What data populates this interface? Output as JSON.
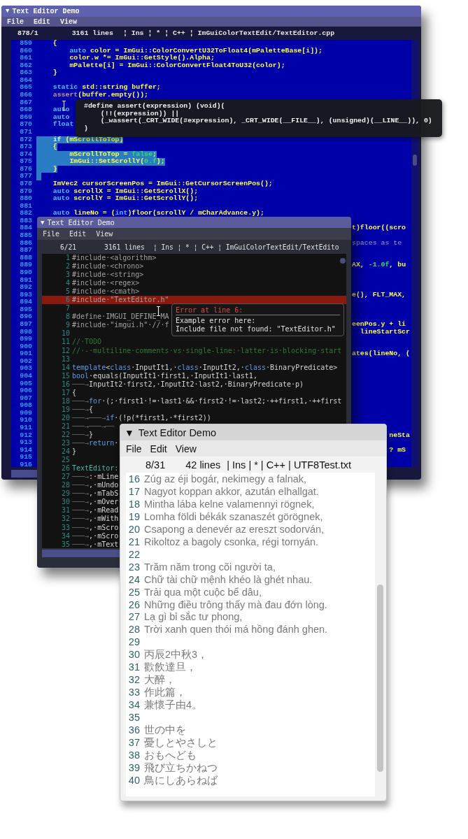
{
  "windows": [
    {
      "kind": "retro-blue",
      "collapse_glyph": "▼",
      "title": "Text Editor Demo",
      "menu": [
        "File",
        "Edit",
        "View"
      ],
      "status": {
        "position": "878/1",
        "lines": "3161 lines",
        "info": "¦ Ins ¦ * ¦ C++ ¦ ImGuiColorTextEdit/TextEditor.cpp"
      },
      "lines": [
        {
          "n": "859",
          "s": [
            {
              "kind": "plain",
              "text": "    {"
            }
          ],
          "selected": false
        },
        {
          "n": "860",
          "s": [
            {
              "kind": "keyword",
              "text": "        auto"
            },
            {
              "kind": "plain",
              "text": " color = ImGui::ColorConvertU32ToFloat4(mPaletteBase[i]);"
            }
          ],
          "selected": false
        },
        {
          "n": "861",
          "s": [
            {
              "kind": "plain",
              "text": "        color.w *= ImGui::GetStyle().Alpha;"
            }
          ],
          "selected": false
        },
        {
          "n": "862",
          "s": [
            {
              "kind": "plain",
              "text": "        mPalette[i] = ImGui::ColorConvertFloat4ToU32(color);"
            }
          ],
          "selected": false
        },
        {
          "n": "863",
          "s": [
            {
              "kind": "plain",
              "text": "    }"
            }
          ],
          "selected": false
        },
        {
          "n": "864",
          "selected": false
        },
        {
          "n": "865",
          "s": [
            {
              "kind": "keyword",
              "text": "    static"
            },
            {
              "kind": "plain",
              "text": " std::string buffer;"
            }
          ],
          "selected": false
        },
        {
          "n": "866",
          "s": [
            {
              "kind": "macro",
              "text": "    assert"
            },
            {
              "kind": "plain",
              "text": "(buffer.empty());"
            }
          ],
          "selected": false
        },
        {
          "n": "867",
          "selected": false
        },
        {
          "n": "868",
          "s": [
            {
              "kind": "keyword",
              "text": "    auto"
            }
          ],
          "selected": false
        },
        {
          "n": "869",
          "s": [
            {
              "kind": "keyword",
              "text": "    auto"
            }
          ],
          "selected": false
        },
        {
          "n": "870",
          "s": [
            {
              "kind": "keyword",
              "text": "    float"
            }
          ],
          "selected": false
        },
        {
          "n": "871",
          "selected": false
        },
        {
          "n": "872",
          "s": [
            {
              "kind": "keyword",
              "text": "    if"
            },
            {
              "kind": "plain",
              "text": " (mScrollToTop)"
            }
          ],
          "selected": true
        },
        {
          "n": "873",
          "s": [
            {
              "kind": "plain",
              "text": "    {"
            }
          ],
          "selected": true
        },
        {
          "n": "874",
          "s": [
            {
              "kind": "plain",
              "text": "        mScrollToTop = "
            },
            {
              "kind": "number",
              "text": "false"
            },
            {
              "kind": "plain",
              "text": ";"
            }
          ],
          "selected": true
        },
        {
          "n": "875",
          "s": [
            {
              "kind": "plain",
              "text": "        ImGui::SetScrollY("
            },
            {
              "kind": "number",
              "text": "0.f"
            },
            {
              "kind": "plain",
              "text": ");"
            }
          ],
          "selected": true
        },
        {
          "n": "876",
          "s": [
            {
              "kind": "plain",
              "text": "    }"
            }
          ],
          "selected": true
        },
        {
          "n": "877",
          "selected": true
        },
        {
          "n": "878",
          "s": [
            {
              "kind": "plain",
              "text": "    ImVec2 cursorScreenPos = ImGui::GetCursorScreenPos();"
            }
          ],
          "selected": false
        },
        {
          "n": "879",
          "s": [
            {
              "kind": "keyword",
              "text": "    auto"
            },
            {
              "kind": "plain",
              "text": " scrollX = ImGui::GetScrollX();"
            }
          ],
          "selected": false
        },
        {
          "n": "880",
          "s": [
            {
              "kind": "keyword",
              "text": "    auto"
            },
            {
              "kind": "plain",
              "text": " scrollY = ImGui::GetScrollY();"
            }
          ],
          "selected": false
        },
        {
          "n": "881",
          "selected": false
        },
        {
          "n": "882",
          "s": [
            {
              "kind": "keyword",
              "text": "    auto"
            },
            {
              "kind": "plain",
              "text": " lineNo = ("
            },
            {
              "kind": "keyword",
              "text": "int"
            },
            {
              "kind": "plain",
              "text": ")floor(scrollY / mCharAdvance.y);"
            }
          ],
          "selected": false
        }
      ],
      "covered_lines": [
        {
          "n": "883"
        },
        {
          "n": "884",
          "tail": [
            {
              "kind": "plain",
              "text": "t)floor((scro"
            }
          ]
        },
        {
          "n": "885"
        },
        {
          "n": "886",
          "tail": [
            {
              "kind": "comment",
              "text": "spaces as te"
            }
          ]
        },
        {
          "n": "887"
        },
        {
          "n": "888"
        },
        {
          "n": "889",
          "tail": [
            {
              "kind": "plain",
              "text": "AX, "
            },
            {
              "kind": "number",
              "text": "-1.0f"
            },
            {
              "kind": "plain",
              "text": ", bu"
            }
          ]
        },
        {
          "n": "890"
        },
        {
          "n": "891"
        },
        {
          "n": "892"
        },
        {
          "n": "893",
          "tail": [
            {
              "kind": "plain",
              "text": "e(), FLT_MAX,"
            }
          ]
        },
        {
          "n": "894"
        },
        {
          "n": "895"
        },
        {
          "n": "896"
        },
        {
          "n": "897",
          "tail": [
            {
              "kind": "plain",
              "text": "eenPos.y + li"
            }
          ]
        },
        {
          "n": "898",
          "tail": [
            {
              "kind": "plain",
              "text": "  lineStartScr"
            }
          ]
        },
        {
          "n": "899"
        },
        {
          "n": "900"
        },
        {
          "n": "901",
          "tail": [
            {
              "kind": "plain",
              "text": "ates(lineNo, ("
            }
          ]
        },
        {
          "n": "902"
        },
        {
          "n": "903"
        },
        {
          "n": "904"
        },
        {
          "n": "905"
        },
        {
          "n": "906"
        },
        {
          "n": "907"
        },
        {
          "n": "908"
        },
        {
          "n": "909"
        },
        {
          "n": "910"
        },
        {
          "n": "911"
        },
        {
          "n": "912",
          "tail": [
            {
              "kind": "plain",
              "text": "         neSta"
            }
          ]
        },
        {
          "n": "913"
        },
        {
          "n": "914",
          "tail": [
            {
              "kind": "plain",
              "text": "         ? mS"
            }
          ]
        },
        {
          "n": "915"
        },
        {
          "n": "916"
        }
      ],
      "tooltip": {
        "lines": [
          "#define assert(expression) (void)(",
          "    (!!(expression)) ||",
          "    (_wassert(_CRT_WIDE(#expression), _CRT_WIDE(__FILE__), (unsigned)(__LINE__)), 0)",
          ")"
        ]
      }
    },
    {
      "kind": "dark",
      "collapse_glyph": "▼",
      "title": "Text Editor Demo",
      "menu": [
        "File",
        "Edit",
        "View"
      ],
      "status": {
        "position": "6/21",
        "lines": "3161 lines",
        "info": "¦ Ins ¦ * ¦ C++ ¦ ImGuiColorTextEdit/TextEdito"
      },
      "lines": [
        {
          "n": "1",
          "s": [
            {
              "kind": "preproc",
              "text": "#include·<algorithm>"
            }
          ],
          "error": false
        },
        {
          "n": "2",
          "s": [
            {
              "kind": "preproc",
              "text": "#include·<chrono>"
            }
          ],
          "error": false
        },
        {
          "n": "3",
          "s": [
            {
              "kind": "preproc",
              "text": "#include·<string>"
            }
          ],
          "error": false
        },
        {
          "n": "4",
          "s": [
            {
              "kind": "preproc",
              "text": "#include·<regex>"
            }
          ],
          "error": false
        },
        {
          "n": "5",
          "s": [
            {
              "kind": "preproc",
              "text": "#include·<cmath>"
            }
          ],
          "error": false
        },
        {
          "n": "6",
          "s": [
            {
              "kind": "preproc",
              "text": "#include·\"TextEditor.h\""
            }
          ],
          "error": true
        },
        {
          "n": "7",
          "error": false
        },
        {
          "n": "8",
          "s": [
            {
              "kind": "preproc",
              "text": "#define·IMGUI_DEFINE_MA"
            }
          ],
          "error": false
        },
        {
          "n": "9",
          "s": [
            {
              "kind": "preproc",
              "text": "#include·\"imgui.h\"·//·f"
            }
          ],
          "error": false
        },
        {
          "n": "10",
          "error": false
        },
        {
          "n": "11",
          "s": [
            {
              "kind": "comment",
              "text": "//·TODO"
            }
          ],
          "error": false
        },
        {
          "n": "12",
          "s": [
            {
              "kind": "comment",
              "text": "//·-·multiline·comments·vs·single-line:·latter·is·blocking·start"
            }
          ],
          "error": false
        },
        {
          "n": "13",
          "error": false
        },
        {
          "n": "14",
          "s": [
            {
              "kind": "keyword",
              "text": "template"
            },
            {
              "kind": "plain",
              "text": "<"
            },
            {
              "kind": "keyword",
              "text": "class"
            },
            {
              "kind": "plain",
              "text": "·InputIt1,·"
            },
            {
              "kind": "keyword",
              "text": "class"
            },
            {
              "kind": "plain",
              "text": "·InputIt2,·"
            },
            {
              "kind": "keyword",
              "text": "class"
            },
            {
              "kind": "plain",
              "text": "·BinaryPredicate>"
            }
          ],
          "error": false
        },
        {
          "n": "15",
          "s": [
            {
              "kind": "keyword",
              "text": "bool"
            },
            {
              "kind": "plain",
              "text": "·equals(InputIt1·first1,·InputIt1·last1,"
            }
          ],
          "error": false
        },
        {
          "n": "16",
          "s": [
            {
              "kind": "tab",
              "text": "───→"
            },
            {
              "kind": "plain",
              "text": "InputIt2·first2,·InputIt2·last2,·BinaryPredicate·p)"
            }
          ],
          "error": false
        },
        {
          "n": "17",
          "s": [
            {
              "kind": "plain",
              "text": "{"
            }
          ],
          "error": false
        },
        {
          "n": "18",
          "s": [
            {
              "kind": "tab",
              "text": "───→"
            },
            {
              "kind": "keyword",
              "text": "for"
            },
            {
              "kind": "plain",
              "text": "·(;·first1·!=·last1·&&·first2·!=·last2;·++first1,·++first"
            }
          ],
          "error": false
        },
        {
          "n": "19",
          "s": [
            {
              "kind": "tab",
              "text": "───→"
            },
            {
              "kind": "plain",
              "text": "{"
            }
          ],
          "error": false
        },
        {
          "n": "20",
          "s": [
            {
              "kind": "tab",
              "text": "───→───→"
            },
            {
              "kind": "keyword",
              "text": "if"
            },
            {
              "kind": "plain",
              "text": "·(!p(*first1,·*first2))"
            }
          ],
          "error": false
        },
        {
          "n": "21",
          "s": [
            {
              "kind": "tab",
              "text": "───→───→──"
            }
          ],
          "error": false
        },
        {
          "n": "22",
          "s": [
            {
              "kind": "tab",
              "text": "───→"
            },
            {
              "kind": "plain",
              "text": "}"
            }
          ],
          "error": false
        },
        {
          "n": "23",
          "s": [
            {
              "kind": "tab",
              "text": "───→"
            },
            {
              "kind": "keyword",
              "text": "return"
            },
            {
              "kind": "plain",
              "text": "·"
            }
          ],
          "error": false
        },
        {
          "n": "24",
          "s": [
            {
              "kind": "plain",
              "text": "}"
            }
          ],
          "error": false
        },
        {
          "n": "25",
          "error": false
        },
        {
          "n": "26",
          "s": [
            {
              "kind": "type",
              "text": "TextEditor:"
            }
          ],
          "error": false
        },
        {
          "n": "27",
          "s": [
            {
              "kind": "tab",
              "text": "───→"
            },
            {
              "kind": "plain",
              "text": ":·mLine"
            }
          ],
          "error": false
        },
        {
          "n": "28",
          "s": [
            {
              "kind": "tab",
              "text": "───→"
            },
            {
              "kind": "plain",
              "text": ",·mUndo"
            }
          ],
          "error": false
        },
        {
          "n": "29",
          "s": [
            {
              "kind": "tab",
              "text": "───→"
            },
            {
              "kind": "plain",
              "text": ",·mTabS"
            }
          ],
          "error": false
        },
        {
          "n": "30",
          "s": [
            {
              "kind": "tab",
              "text": "───→"
            },
            {
              "kind": "plain",
              "text": ",·mOver"
            }
          ],
          "error": false
        },
        {
          "n": "31",
          "s": [
            {
              "kind": "tab",
              "text": "───→"
            },
            {
              "kind": "plain",
              "text": ",·mRead"
            }
          ],
          "error": false
        },
        {
          "n": "32",
          "s": [
            {
              "kind": "tab",
              "text": "───→"
            },
            {
              "kind": "plain",
              "text": ",·mWith"
            }
          ],
          "error": false
        },
        {
          "n": "33",
          "s": [
            {
              "kind": "tab",
              "text": "───→"
            },
            {
              "kind": "plain",
              "text": ",·mScro"
            }
          ],
          "error": false
        },
        {
          "n": "34",
          "s": [
            {
              "kind": "tab",
              "text": "───→"
            },
            {
              "kind": "plain",
              "text": ",·mScro"
            }
          ],
          "error": false
        },
        {
          "n": "35",
          "s": [
            {
              "kind": "tab",
              "text": "───→"
            },
            {
              "kind": "plain",
              "text": ",·mText"
            }
          ],
          "error": false
        }
      ],
      "tooltip": {
        "title": "Error at line 6:",
        "lines": [
          "Example error here:",
          "Include file not found: \"TextEditor.h\""
        ]
      }
    },
    {
      "kind": "light",
      "collapse_glyph": "▼",
      "title": "Text Editor Demo",
      "menu": [
        "File",
        "Edit",
        "View"
      ],
      "status": {
        "position": "8/31",
        "lines": "42 lines",
        "info": "| Ins | * | C++ | UTF8Test.txt"
      },
      "lines": [
        {
          "n": "16",
          "text": "Zúg az éji bogár, nekimegy a falnak,"
        },
        {
          "n": "17",
          "text": "Nagyot koppan akkor, azután elhallgat."
        },
        {
          "n": "18",
          "text": "Mintha lába kelne valamennyi rögnek,"
        },
        {
          "n": "19",
          "text": "Lomha földi békák szanaszét görögnek,"
        },
        {
          "n": "20",
          "text": "Csapong a denevér az ereszt sodorván,"
        },
        {
          "n": "21",
          "text": "Rikoltoz a bagoly csonka, régi tornyán."
        },
        {
          "n": "22"
        },
        {
          "n": "23",
          "text": "Trăm năm trong cõi người ta,"
        },
        {
          "n": "24",
          "text": "Chữ tài chữ mệnh khéo là ghét nhau."
        },
        {
          "n": "25",
          "text": "Trải qua một cuộc bể dâu,"
        },
        {
          "n": "26",
          "text": "Những điều trông thấy mà đau đớn lòng."
        },
        {
          "n": "27",
          "text": "Lạ gì bỉ sắc tư phong,"
        },
        {
          "n": "28",
          "text": "Trời xanh quen thói má hồng đánh ghen."
        },
        {
          "n": "29"
        },
        {
          "n": "30",
          "text": "丙辰2中秋3，"
        },
        {
          "n": "31",
          "text": "歡飲達旦，"
        },
        {
          "n": "32",
          "text": "大醉，"
        },
        {
          "n": "33",
          "text": "作此篇，"
        },
        {
          "n": "34",
          "text": "兼懷子由4。"
        },
        {
          "n": "35"
        },
        {
          "n": "36",
          "text": "世の中を"
        },
        {
          "n": "37",
          "text": "憂しとやさしと"
        },
        {
          "n": "38",
          "text": "おもへども"
        },
        {
          "n": "39",
          "text": "飛び立ちかねつ"
        },
        {
          "n": "40",
          "text": "鳥にしあらねば"
        }
      ]
    }
  ]
}
